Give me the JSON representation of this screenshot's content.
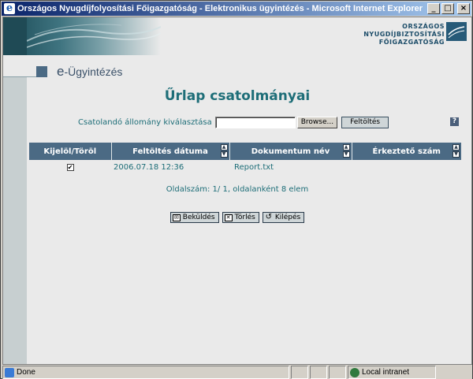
{
  "window": {
    "title": "Országos Nyugdíjfolyosítási Főigazgatóság - Elektronikus ügyintézés - Microsoft Internet Explorer",
    "minimize": "_",
    "maximize": "□",
    "close": "×"
  },
  "header": {
    "logo_line1": "ORSZÁGOS",
    "logo_line2": "NYUGDÍJBIZTOSÍTÁSI",
    "logo_line3": "FŐIGAZGATÓSÁG"
  },
  "section": {
    "title_e": "e",
    "title_rest": "-Ügyintézés"
  },
  "page": {
    "title": "Űrlap csatolmányai"
  },
  "upload": {
    "label": "Csatolandó állomány kiválasztása",
    "browse_label": "Browse...",
    "upload_label": "Feltöltés",
    "help": "?"
  },
  "table": {
    "columns": [
      "Kijelöl/Töröl",
      "Feltöltés dátuma",
      "Dokumentum név",
      "Érkeztető szám"
    ],
    "rows": [
      {
        "checked": "✔",
        "date": "2006.07.18 12:36",
        "name": "Report.txt",
        "number": ""
      }
    ]
  },
  "pager": {
    "text": "Oldalszám: 1/ 1, oldalanként 8 elem"
  },
  "actions": {
    "send_label": "Beküldés",
    "delete_label": "Törlés",
    "exit_label": "Kilépés"
  },
  "statusbar": {
    "status": "Done",
    "zone": "Local intranet"
  },
  "colors": {
    "accent": "#1e6e78",
    "header_bg": "#4b6a84"
  }
}
